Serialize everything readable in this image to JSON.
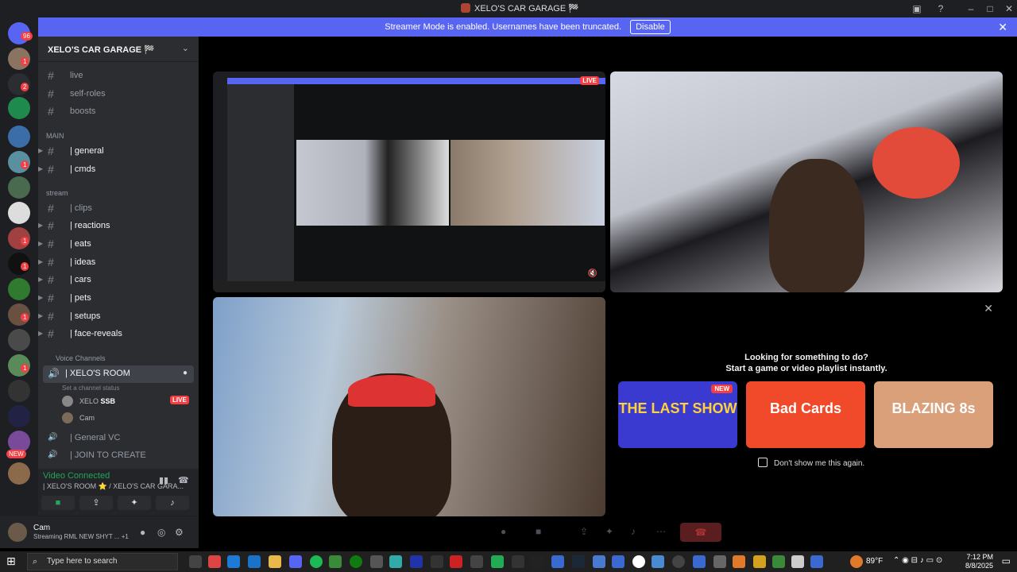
{
  "window": {
    "title": "XELO'S CAR GARAGE 🏁"
  },
  "banner": {
    "text": "Streamer Mode is enabled. Usernames have been truncated.",
    "button": "Disable"
  },
  "guild_badges": [
    "96",
    "1",
    "2",
    "1",
    "1",
    "1",
    "1",
    "1",
    "1",
    "1",
    "1",
    "1",
    "1"
  ],
  "guild_new": "NEW",
  "server": {
    "name": "XELO'S CAR GARAGE 🏁"
  },
  "channels_top": [
    "live",
    "self-roles",
    "boosts"
  ],
  "cat_main": "MAIN",
  "channels_main": [
    "| general",
    "| cmds"
  ],
  "cat_stream": "stream",
  "channels_stream": [
    "| clips",
    "| reactions",
    "| eats",
    "| ideas",
    "| cars",
    "| pets",
    "| setups",
    "| face-reveals"
  ],
  "cat_voice": "Voice Channels",
  "voice_active": {
    "name": "| XELO'S ROOM",
    "status": "Set a channel status"
  },
  "voice_users": [
    {
      "name": "XELO",
      "tag": "SSB",
      "live": "LIVE"
    },
    {
      "name": "Cam"
    }
  ],
  "voice_other": [
    "| General VC",
    "| JOIN TO CREATE"
  ],
  "voice_conn": {
    "title": "Video Connected",
    "sub": "| XELO'S ROOM ⭐ / XELO'S CAR GARA..."
  },
  "user": {
    "name": "Cam",
    "status": "Streaming RML NEW SHYT ...",
    "plus": "+1"
  },
  "stream_live": "LIVE",
  "activity": {
    "h1": "Looking for something to do?",
    "h2": "Start a game or video playlist instantly.",
    "games": [
      {
        "title": "THE LAST SHOW",
        "badge": "NEW",
        "color": "#3a3ad0"
      },
      {
        "title": "Bad Cards",
        "color": "#f04a2a"
      },
      {
        "title": "BLAZING 8s",
        "color": "#d9a07a"
      }
    ],
    "dont": "Don't show me this again."
  },
  "taskbar": {
    "search": "Type here to search",
    "weather": "89°F",
    "time": "7:12 PM",
    "date": "8/8/2025"
  }
}
